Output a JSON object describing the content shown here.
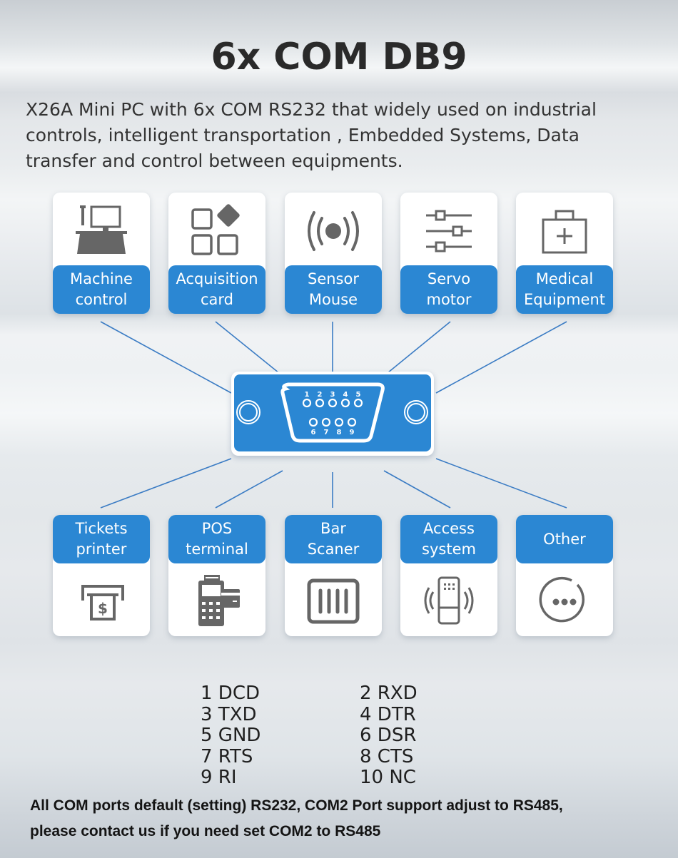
{
  "title": "6x COM DB9",
  "intro": "X26A Mini PC with 6x COM RS232 that widely used on industrial controls, intelligent transportation , Embedded Systems, Data transfer and control between equipments.",
  "colors": {
    "accent": "#2b87d3",
    "icon_gray": "#666666",
    "connector_line": "#3b7cc4"
  },
  "top_devices": [
    {
      "label_line1": "Machine",
      "label_line2": "control",
      "icon": "machine-control-icon"
    },
    {
      "label_line1": "Acquisition",
      "label_line2": "card",
      "icon": "acquisition-card-icon"
    },
    {
      "label_line1": "Sensor",
      "label_line2": "Mouse",
      "icon": "sensor-icon"
    },
    {
      "label_line1": "Servo",
      "label_line2": "motor",
      "icon": "sliders-icon"
    },
    {
      "label_line1": "Medical",
      "label_line2": "Equipment",
      "icon": "medical-kit-icon"
    }
  ],
  "bottom_devices": [
    {
      "label_line1": "Tickets",
      "label_line2": "printer",
      "icon": "ticket-printer-icon"
    },
    {
      "label_line1": "POS",
      "label_line2": "terminal",
      "icon": "pos-terminal-icon"
    },
    {
      "label_line1": "Bar",
      "label_line2": "Scaner",
      "icon": "barcode-scanner-icon"
    },
    {
      "label_line1": "Access",
      "label_line2": "system",
      "icon": "access-card-reader-icon"
    },
    {
      "label_line1": "Other",
      "label_line2": "",
      "icon": "more-options-icon"
    }
  ],
  "connector": {
    "name": "DB9",
    "top_row_pins": [
      "1",
      "2",
      "3",
      "4",
      "5"
    ],
    "bottom_row_pins": [
      "6",
      "7",
      "8",
      "9"
    ]
  },
  "pinout": {
    "left": [
      "1 DCD",
      "3 TXD",
      "5 GND",
      "7 RTS",
      "9 RI"
    ],
    "right": [
      "2 RXD",
      "4 DTR",
      "6 DSR",
      "8 CTS",
      "10 NC"
    ]
  },
  "note": {
    "line1": "All COM ports default (setting) RS232,  COM2 Port support adjust to RS485,",
    "line2": "please contact us if you need set COM2 to RS485"
  }
}
